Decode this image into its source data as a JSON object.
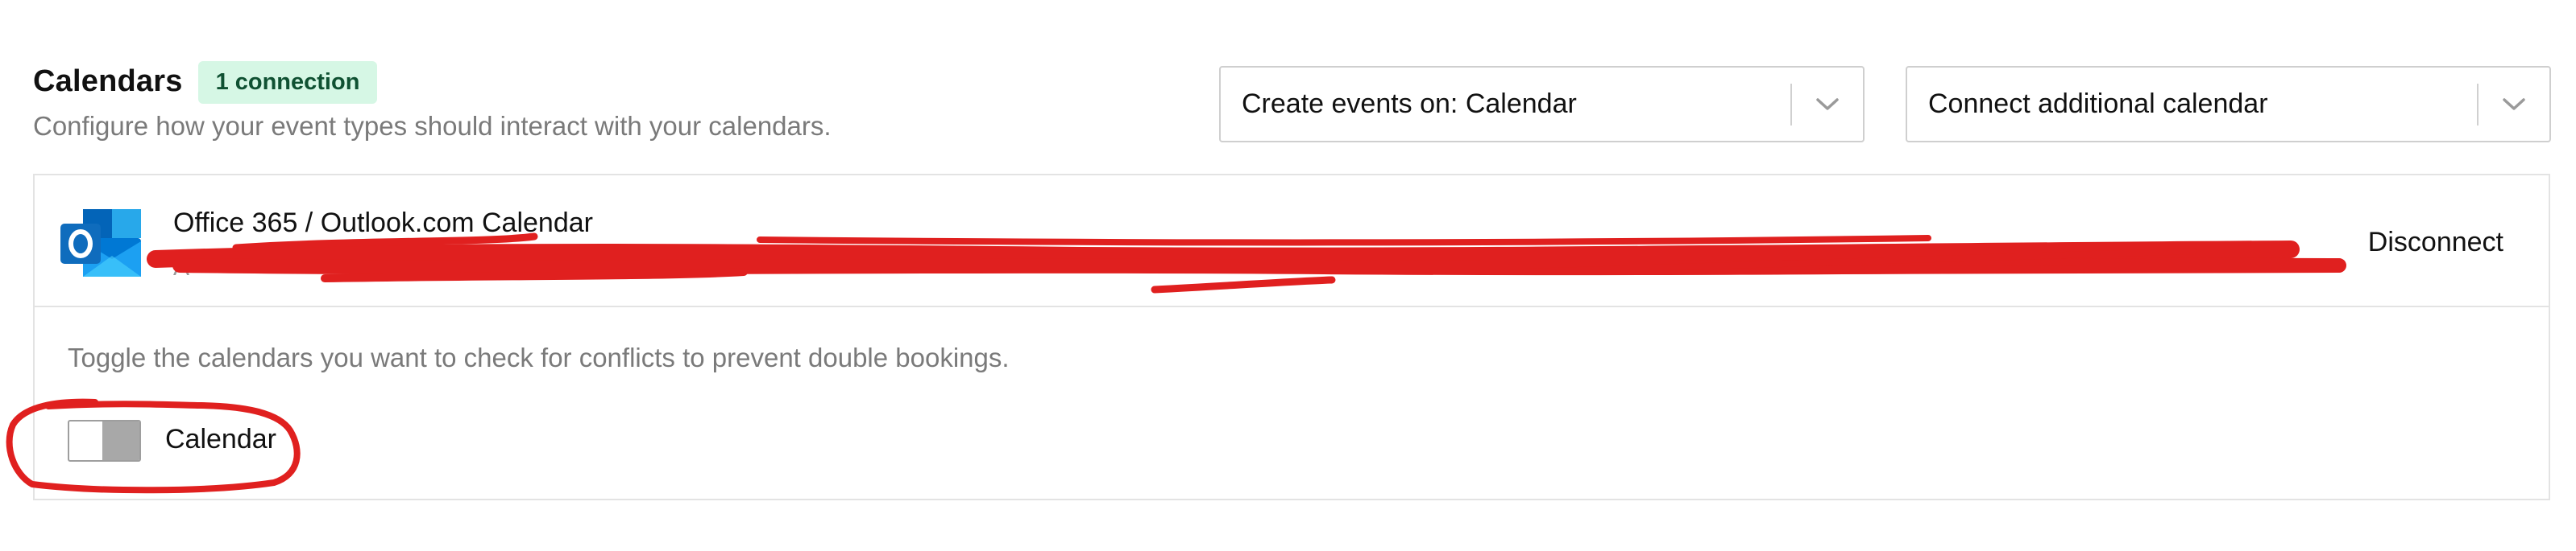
{
  "header": {
    "title": "Calendars",
    "badge": "1 connection",
    "subtitle": "Configure how your event types should interact with your calendars."
  },
  "create_events": {
    "value": "Create events on:  Calendar",
    "icon": "chevron-down-icon"
  },
  "connect_additional": {
    "value": "Connect additional calendar",
    "icon": "chevron-down-icon"
  },
  "connection": {
    "name": "Office 365 / Outlook.com Calendar",
    "account_redacted": "A",
    "logo": "outlook-icon",
    "disconnect_label": "Disconnect"
  },
  "conflicts": {
    "hint": "Toggle the calendars you want to check for conflicts to prevent double bookings.",
    "calendars": [
      {
        "label": "Calendar",
        "enabled": false
      }
    ]
  },
  "colors": {
    "badge_bg": "#d6f7e5",
    "badge_text": "#0f5132",
    "annotation_red": "#e0201f",
    "outlook_blue": "#0f6cbd"
  }
}
